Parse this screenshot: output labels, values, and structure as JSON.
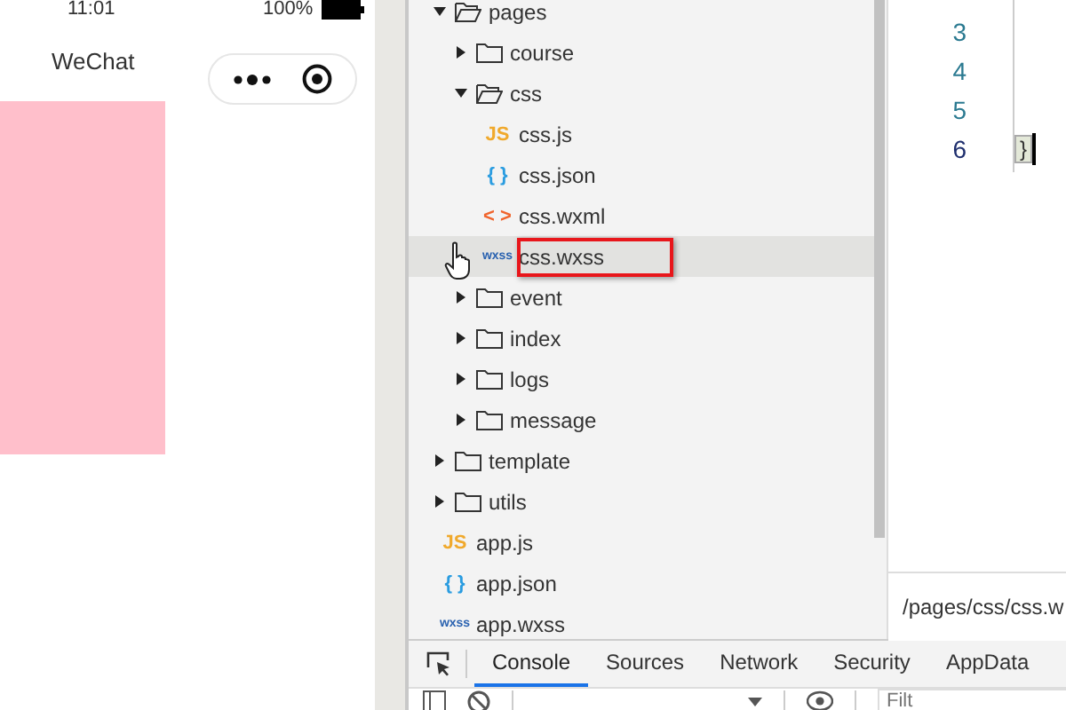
{
  "phone": {
    "time": "11:01",
    "battery": "100%",
    "title": "WeChat"
  },
  "tree": [
    {
      "name": "pages",
      "kind": "folder",
      "expanded": true,
      "selected": false,
      "children": [
        {
          "name": "course",
          "kind": "folder",
          "expanded": false,
          "selected": false
        },
        {
          "name": "css",
          "kind": "folder",
          "expanded": true,
          "selected": false,
          "children": [
            {
              "name": "css.js",
              "kind": "js",
              "icon": "JS",
              "selected": false
            },
            {
              "name": "css.json",
              "kind": "json",
              "icon": "{ }",
              "selected": false
            },
            {
              "name": "css.wxml",
              "kind": "wxml",
              "icon": "< >",
              "selected": false
            },
            {
              "name": "css.wxss",
              "kind": "wxss",
              "icon": "wxss",
              "selected": true
            }
          ]
        },
        {
          "name": "event",
          "kind": "folder",
          "expanded": false,
          "selected": false
        },
        {
          "name": "index",
          "kind": "folder",
          "expanded": false,
          "selected": false
        },
        {
          "name": "logs",
          "kind": "folder",
          "expanded": false,
          "selected": false
        },
        {
          "name": "message",
          "kind": "folder",
          "expanded": false,
          "selected": false
        }
      ]
    },
    {
      "name": "template",
      "kind": "folder",
      "expanded": false,
      "selected": false
    },
    {
      "name": "utils",
      "kind": "folder",
      "expanded": false,
      "selected": false
    },
    {
      "name": "app.js",
      "kind": "js",
      "icon": "JS",
      "selected": false
    },
    {
      "name": "app.json",
      "kind": "json",
      "icon": "{ }",
      "selected": false
    },
    {
      "name": "app.wxss",
      "kind": "wxss",
      "icon": "wxss",
      "selected": false
    }
  ],
  "editor": {
    "line_numbers": [
      "3",
      "4",
      "5",
      "6"
    ],
    "closing_brace": "}",
    "file_path": "/pages/css/css.w"
  },
  "devtools": {
    "tabs": [
      {
        "label": "Console",
        "selected": true
      },
      {
        "label": "Sources",
        "selected": false
      },
      {
        "label": "Network",
        "selected": false
      },
      {
        "label": "Security",
        "selected": false
      },
      {
        "label": "AppData",
        "selected": false
      }
    ],
    "filter": {
      "placeholder": "Filt"
    }
  }
}
